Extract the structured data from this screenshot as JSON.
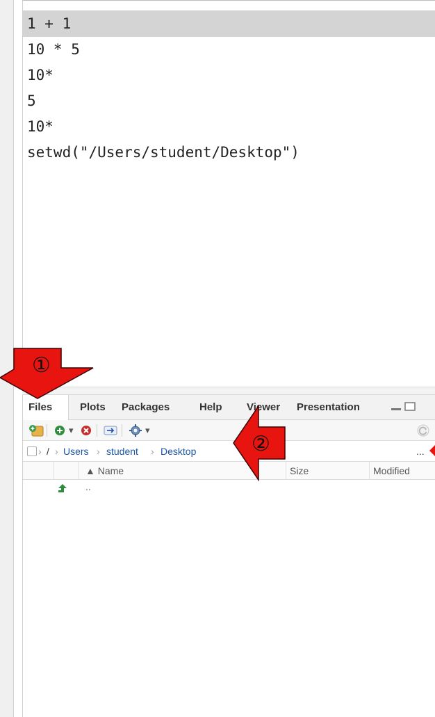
{
  "history": {
    "lines": [
      "1 + 1",
      "10 * 5",
      "10*",
      "5",
      "10*",
      "setwd(\"/Users/student/Desktop\")"
    ],
    "selected_index": 0
  },
  "files_pane": {
    "tabs": [
      "Files",
      "Plots",
      "Packages",
      "Help",
      "Viewer",
      "Presentation"
    ],
    "active_tab": "Files",
    "breadcrumb": {
      "root": "/",
      "parts": [
        "Users",
        "student",
        "Desktop"
      ],
      "more": "..."
    },
    "columns": {
      "name": "▲ Name",
      "size": "Size",
      "modified": "Modified"
    },
    "rows": [
      {
        "name": ".."
      }
    ]
  },
  "annotations": {
    "arrow1": "①",
    "arrow2": "②"
  },
  "colors": {
    "arrow_fill": "#e8140f",
    "arrow_stroke": "#3a0000",
    "link_blue": "#1a56a4",
    "selection_gray": "#d4d4d4",
    "up_arrow_green": "#2e8b3e"
  }
}
